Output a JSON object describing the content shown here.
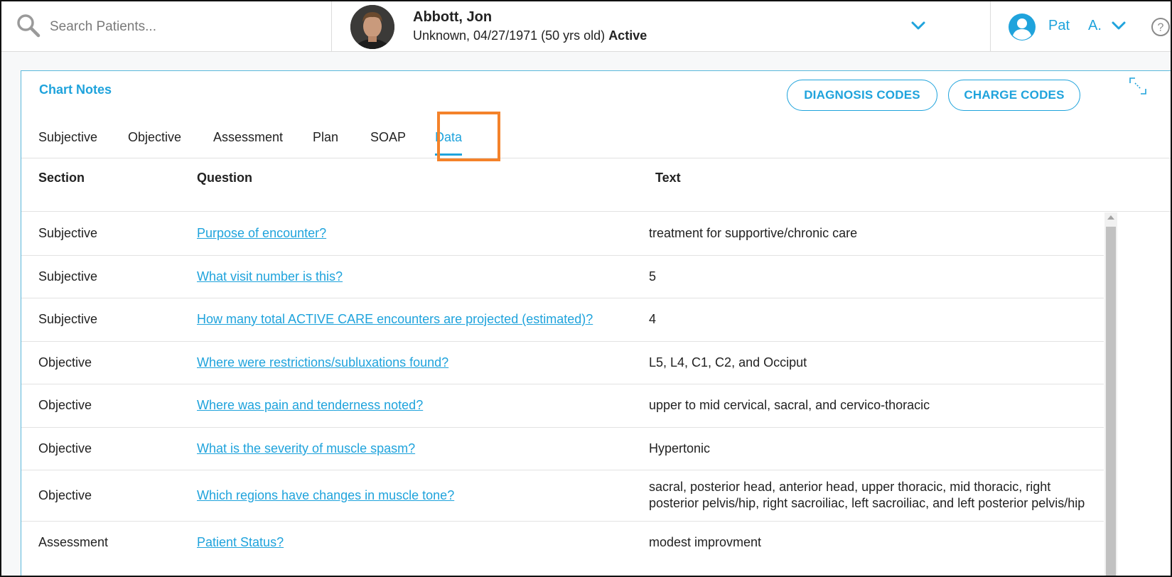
{
  "search": {
    "placeholder": "Search Patients..."
  },
  "patient": {
    "name": "Abbott, Jon",
    "details": "Unknown, 04/27/1971 (50 yrs old)",
    "status": "Active"
  },
  "user": {
    "first": "Pat",
    "last": "A."
  },
  "panel": {
    "title": "Chart Notes",
    "diagnosis_codes_label": "DIAGNOSIS CODES",
    "charge_codes_label": "CHARGE CODES"
  },
  "tabs": [
    {
      "label": "Subjective"
    },
    {
      "label": "Objective"
    },
    {
      "label": "Assessment"
    },
    {
      "label": "Plan"
    },
    {
      "label": "SOAP"
    },
    {
      "label": "Data",
      "active": true
    }
  ],
  "table": {
    "headers": {
      "section": "Section",
      "question": "Question",
      "text": "Text"
    },
    "rows": [
      {
        "section": "Subjective",
        "question": "Purpose of encounter?",
        "text": "treatment for supportive/chronic care"
      },
      {
        "section": "Subjective",
        "question": "What visit number is this?",
        "text": "5"
      },
      {
        "section": "Subjective",
        "question": "How many total ACTIVE CARE encounters are projected (estimated)?",
        "text": "4"
      },
      {
        "section": "Objective",
        "question": "Where were restrictions/subluxations found?",
        "text": "L5, L4, C1, C2, and Occiput"
      },
      {
        "section": "Objective",
        "question": "Where was pain and tenderness noted?",
        "text": "upper to mid cervical, sacral, and cervico-thoracic"
      },
      {
        "section": "Objective",
        "question": "What is the severity of muscle spasm?",
        "text": "Hypertonic"
      },
      {
        "section": "Objective",
        "question": "Which regions have changes in muscle tone?",
        "text": "sacral, posterior head, anterior head, upper thoracic, mid thoracic, right posterior pelvis/hip, right sacroiliac, left sacroiliac, and left posterior pelvis/hip"
      },
      {
        "section": "Assessment",
        "question": "Patient Status?",
        "text": "modest improvment"
      }
    ]
  },
  "colors": {
    "accent": "#1fa3dc",
    "highlight": "#f4822a"
  }
}
